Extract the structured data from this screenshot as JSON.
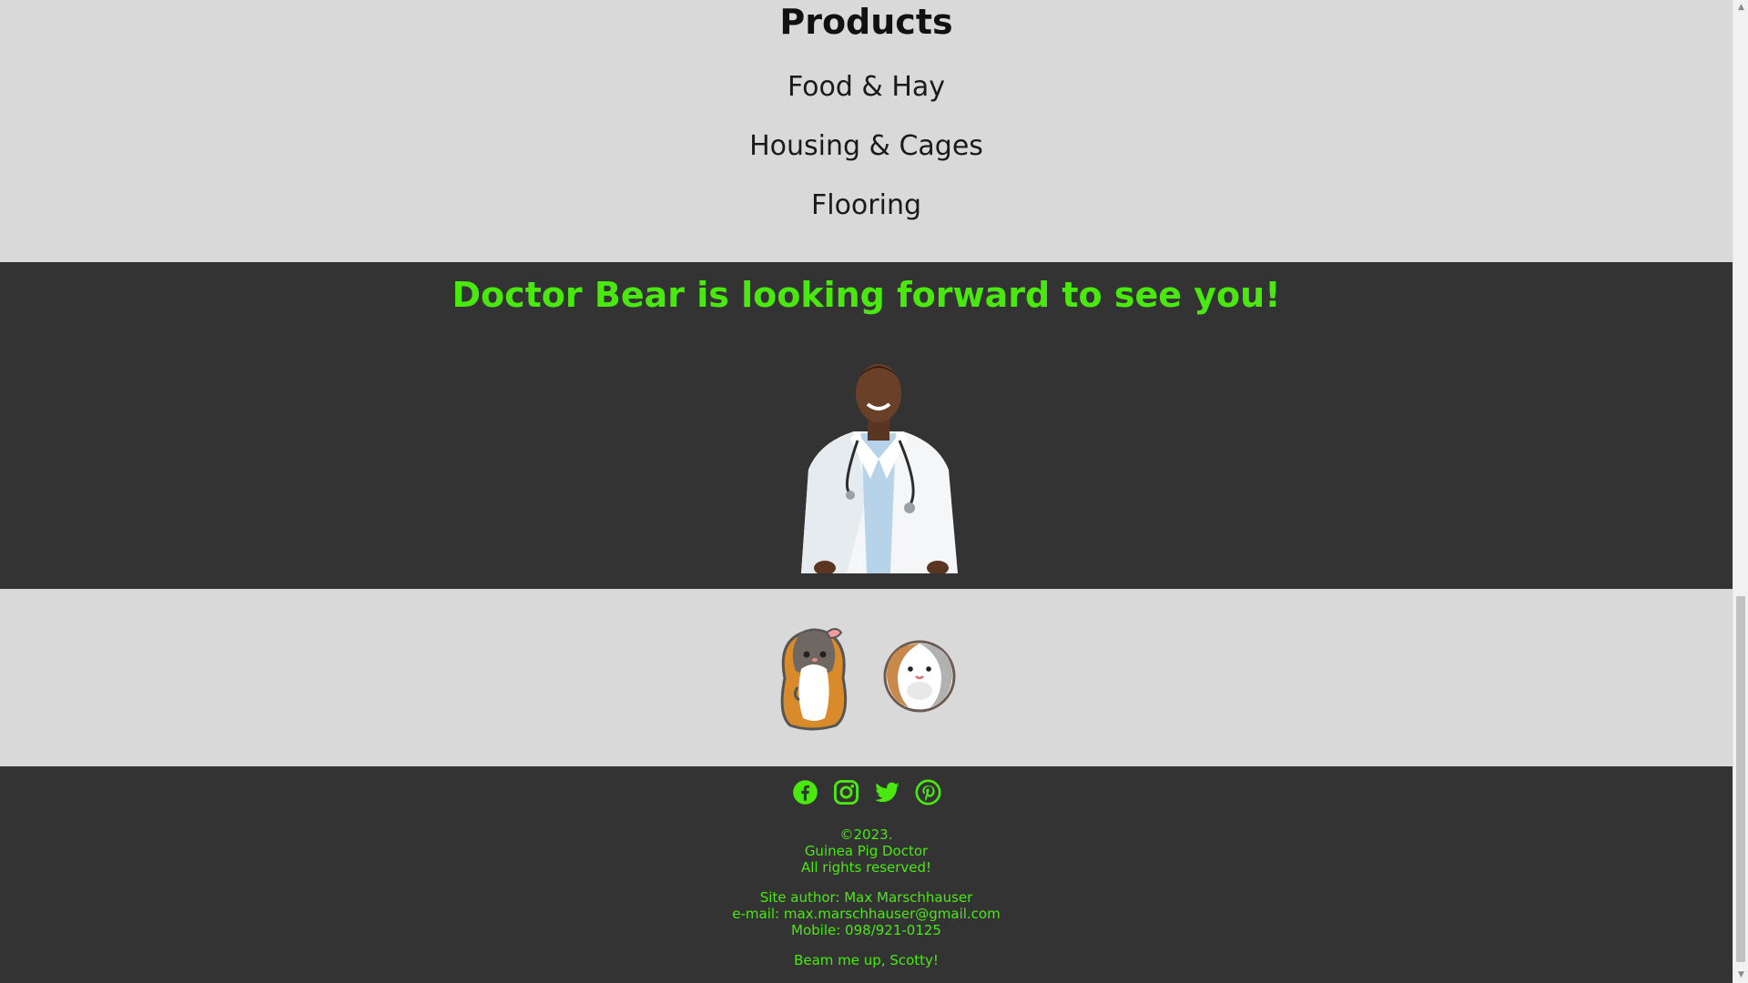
{
  "products": {
    "title": "Products",
    "items": [
      "Food & Hay",
      "Housing & Cages",
      "Flooring"
    ]
  },
  "doctor": {
    "heading": "Doctor Bear is looking forward to see you!",
    "image_alt": "doctor-photo"
  },
  "mascots": {
    "icons": [
      "guinea-pig-standing-icon",
      "guinea-pig-round-icon"
    ]
  },
  "footer": {
    "social": [
      "facebook-icon",
      "instagram-icon",
      "twitter-icon",
      "pinterest-icon"
    ],
    "copyright": [
      "©2023.",
      "Guinea Pig Doctor",
      "All rights reserved!"
    ],
    "author": [
      "Site author: Max Marschhauser",
      "e-mail: max.marschhauser@gmail.com",
      "Mobile: 098/921-0125"
    ],
    "tagline": "Beam me up, Scotty!"
  },
  "colors": {
    "accent": "#4be80f",
    "dark_bg": "#333333",
    "light_bg": "#d9d9d9"
  }
}
